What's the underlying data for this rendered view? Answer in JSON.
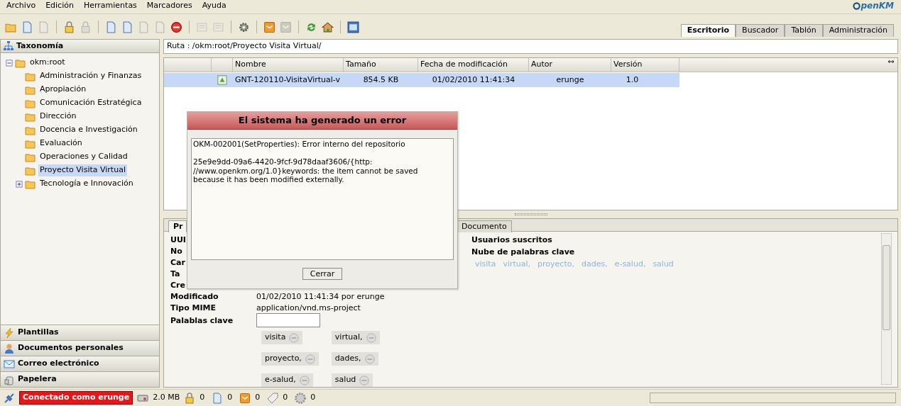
{
  "logo": "penKM",
  "menu": [
    "Archivo",
    "Edición",
    "Herramientas",
    "Marcadores",
    "Ayuda"
  ],
  "toolbar_groups": [
    [
      {
        "disabled": false
      },
      {
        "disabled": false
      },
      {
        "disabled": true
      }
    ],
    [
      {
        "disabled": false
      },
      {
        "disabled": true
      }
    ],
    [
      {
        "disabled": false
      },
      {
        "disabled": false
      },
      {
        "disabled": true
      },
      {
        "disabled": true
      },
      {
        "disabled": false
      }
    ],
    [
      {
        "disabled": true
      },
      {
        "disabled": true
      }
    ],
    [
      {
        "disabled": false
      }
    ],
    [
      {
        "disabled": false
      },
      {
        "disabled": true
      }
    ],
    [
      {
        "disabled": false
      },
      {
        "disabled": false
      }
    ],
    [
      {
        "disabled": false
      }
    ]
  ],
  "main_tabs": [
    {
      "label": "Escritorio",
      "selected": true
    },
    {
      "label": "Buscador",
      "selected": false
    },
    {
      "label": "Tablón",
      "selected": false
    },
    {
      "label": "Administración",
      "selected": false
    }
  ],
  "sidebar": {
    "title": "Taxonomía",
    "tree": [
      {
        "label": "okm:root",
        "expanded": true,
        "selected": false,
        "children": [
          {
            "label": "Administración y Finanzas",
            "selected": false
          },
          {
            "label": "Apropiación",
            "selected": false
          },
          {
            "label": "Comunicación Estratégica",
            "selected": false
          },
          {
            "label": "Dirección",
            "selected": false
          },
          {
            "label": "Docencia e Investigación",
            "selected": false
          },
          {
            "label": "Evaluación",
            "selected": false
          },
          {
            "label": "Operaciones y Calidad",
            "selected": false
          },
          {
            "label": "Proyecto Visita Virtual",
            "selected": true
          },
          {
            "label": "Tecnología e Innovación",
            "selected": false,
            "expanded": false
          }
        ]
      }
    ],
    "sections": [
      "Plantillas",
      "Documentos personales",
      "Correo electrónico",
      "Papelera"
    ]
  },
  "path": "Ruta : /okm:root/Proyecto Visita Virtual/",
  "table": {
    "columns": [
      "Nombre",
      "Tamaño",
      "Fecha de modificación",
      "Autor",
      "Versión"
    ],
    "rows": [
      {
        "selected": true,
        "cells": [
          "GNT-120110-VisitaVirtual-v",
          "854.5 KB",
          "01/02/2010 11:41:34",
          "erunge",
          "1.0"
        ]
      }
    ]
  },
  "properties": {
    "tabs": [
      {
        "label": "Pr",
        "selected": true
      },
      {
        "label": "Documento",
        "selected": false
      }
    ],
    "fields": [
      {
        "label": "UUI"
      },
      {
        "label": "No"
      },
      {
        "label": "Car"
      },
      {
        "label": "Ta"
      },
      {
        "label": "Cre"
      },
      {
        "label": "Modificado",
        "value": "01/02/2010 11:41:34 por erunge"
      },
      {
        "label": "Tipo MIME",
        "value": "application/vnd.ms-project"
      },
      {
        "label": "Palablas clave"
      }
    ],
    "keywords": [
      "visita",
      "virtual,",
      "proyecto,",
      "dades,",
      "e-salud,",
      "salud"
    ],
    "subscribers_label": "Usuarios suscritos",
    "cloud_label": "Nube de palabras clave",
    "cloud": [
      "visita",
      "virtual,",
      "proyecto,",
      "dades,",
      "e-salud,",
      "salud"
    ]
  },
  "dialog": {
    "title": "El sistema ha generado un error",
    "message": "OKM-002001(SetProperties): Error interno del repositorio\n\n25e9e9dd-09a6-4420-9fcf-9d78daaf3606/{http:\n//www.openkm.org/1.0}keywords: the item cannot be saved\nbecause it has been modified externally.",
    "button": "Cerrar"
  },
  "status_bar": {
    "user": "Conectado como erunge",
    "size": "2.0 MB",
    "counts": [
      "0",
      "0",
      "0",
      "0",
      "0"
    ]
  }
}
